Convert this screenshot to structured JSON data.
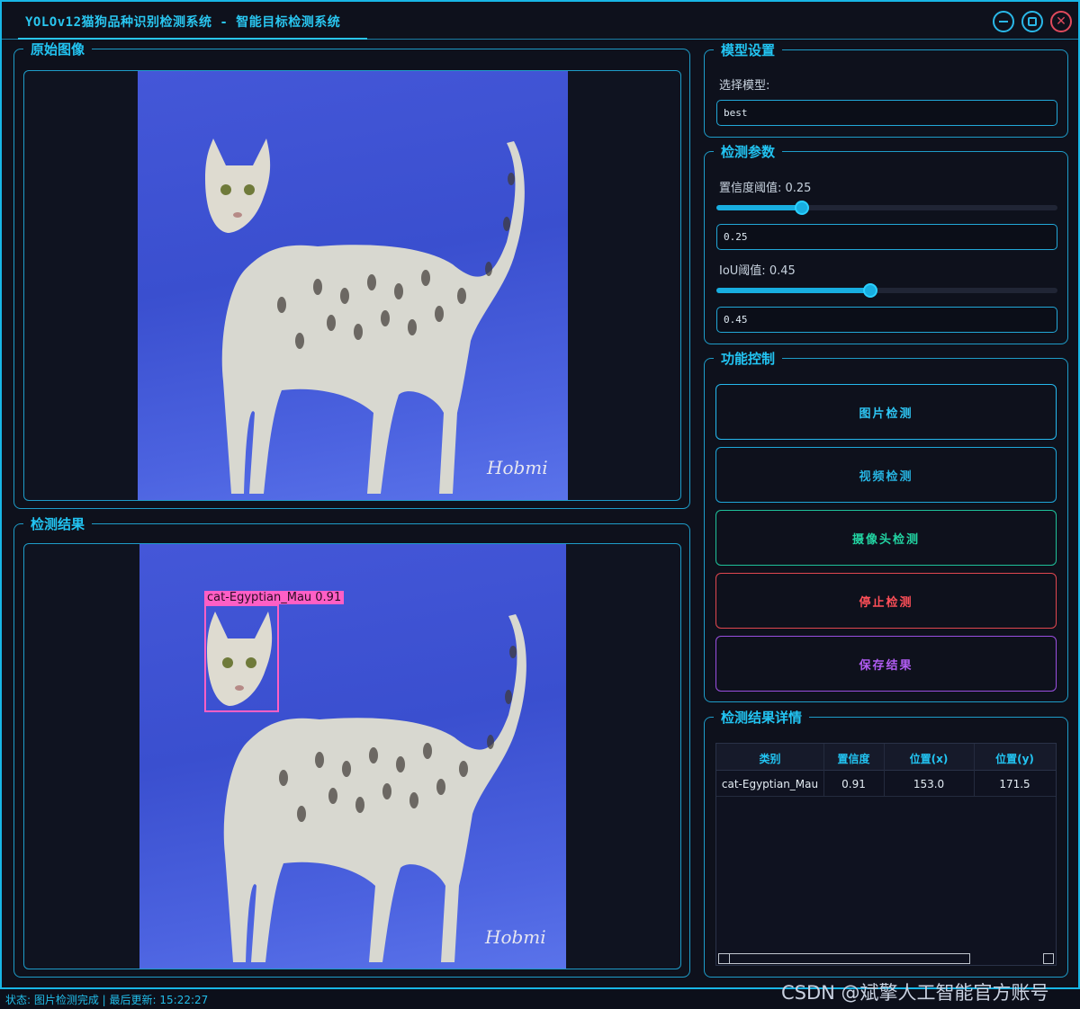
{
  "window": {
    "title": "YOLOv12猫狗品种识别检测系统 - 智能目标检测系统",
    "accent": "#22c4f2"
  },
  "original": {
    "legend": "原始图像",
    "watermark_text": "Hobmi"
  },
  "result": {
    "legend": "检测结果",
    "detection_label": "cat-Egyptian_Mau  0.91",
    "box_color": "#ff5fc5"
  },
  "model": {
    "legend": "模型设置",
    "select_label": "选择模型:",
    "selected": "best"
  },
  "params": {
    "legend": "检测参数",
    "conf_label": "置信度阈值: 0.25",
    "conf_value": "0.25",
    "conf_fraction": 0.25,
    "iou_label": "IoU阈值: 0.45",
    "iou_value": "0.45",
    "iou_fraction": 0.45
  },
  "controls": {
    "legend": "功能控制",
    "image_detect": "图片检测",
    "video_detect": "视频检测",
    "camera_detect": "摄像头检测",
    "stop_detect": "停止检测",
    "save_result": "保存结果"
  },
  "details": {
    "legend": "检测结果详情",
    "columns": [
      "类别",
      "置信度",
      "位置(x)",
      "位置(y)"
    ],
    "rows": [
      [
        "cat-Egyptian_Mau",
        "0.91",
        "153.0",
        "171.5"
      ]
    ]
  },
  "status": {
    "text": "状态: 图片检测完成 | 最后更新: 15:22:27"
  },
  "watermark": "CSDN @斌擎人工智能官方账号"
}
